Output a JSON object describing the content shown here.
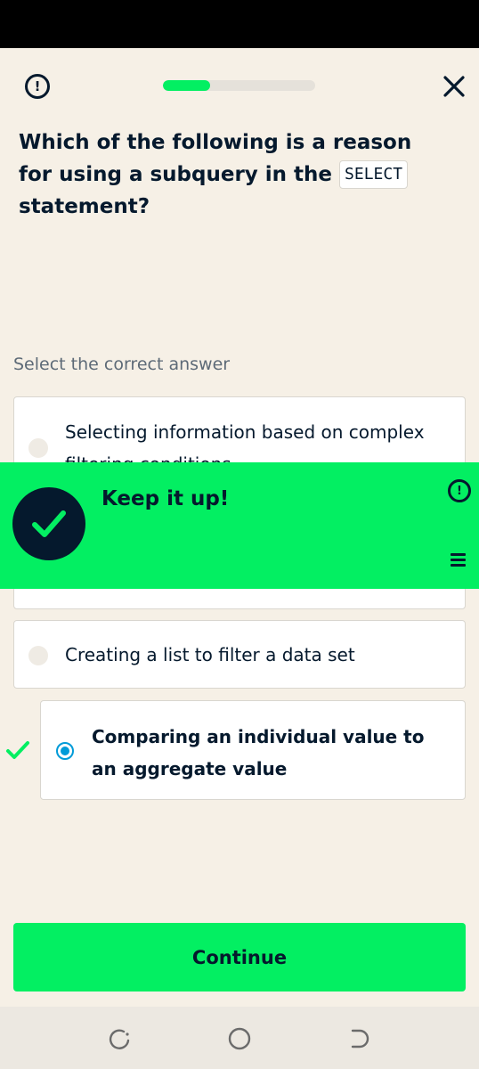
{
  "header": {
    "report_icon": "exclamation-circle-icon",
    "progress": 0.31,
    "close_icon": "close-icon"
  },
  "question": {
    "text_before": "Which of the following is a reason for using a subquery in the",
    "code": "SELECT",
    "text_after": "statement?"
  },
  "instruction": "Select the correct answer",
  "options": [
    {
      "label": "Selecting information based on complex filtering conditions"
    },
    {
      "label": ""
    },
    {
      "label": "Creating a list to filter a data set"
    },
    {
      "label": "Comparing an individual value to an aggregate value",
      "selected": true,
      "correct": true
    }
  ],
  "feedback": {
    "title": "Keep it up!",
    "badge_icon": "checkmark-icon",
    "report_icon": "exclamation-circle-icon",
    "menu_icon": "hamburger-menu-icon"
  },
  "continue_label": "Continue",
  "colors": {
    "accent_green": "#03ef62",
    "navy": "#05192d",
    "background": "#f6f0e6",
    "selected_blue": "#009bd8"
  },
  "system_nav": [
    "recent-apps-icon",
    "home-icon",
    "back-icon"
  ]
}
